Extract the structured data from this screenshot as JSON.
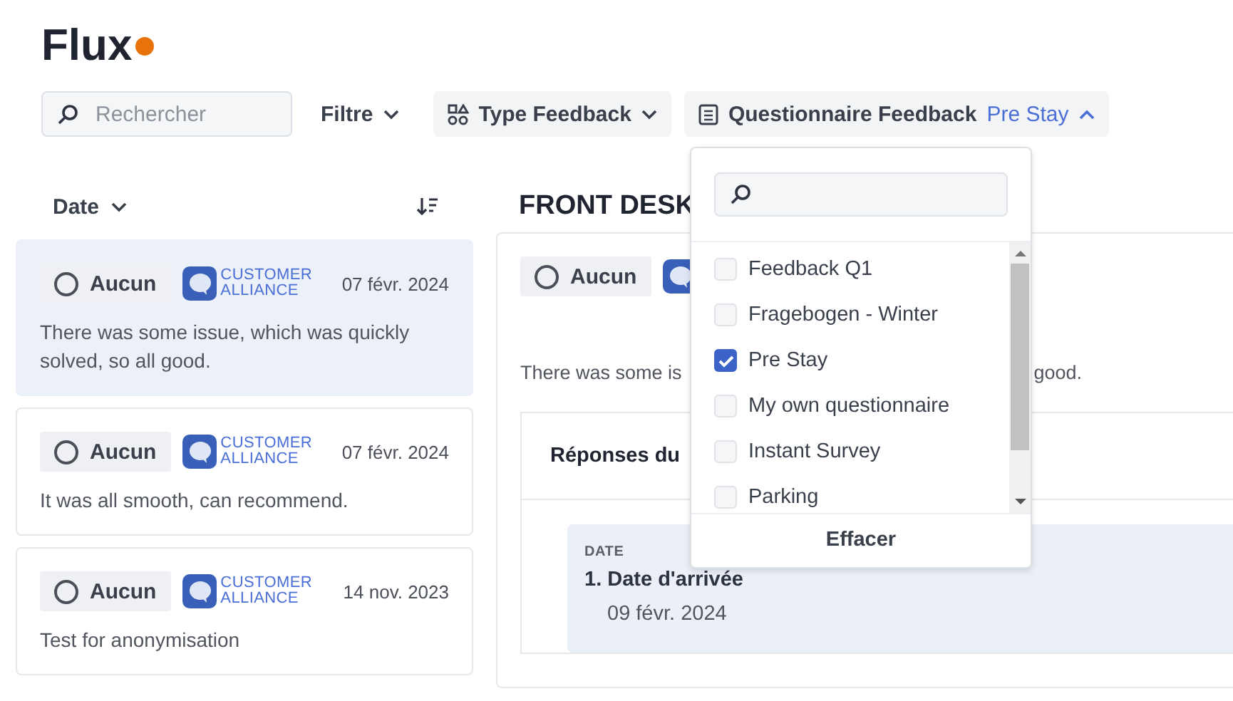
{
  "page": {
    "title": "Flux"
  },
  "toolbar": {
    "search": {
      "placeholder": "Rechercher"
    },
    "filter": {
      "label": "Filtre"
    },
    "type_feedback": {
      "label": "Type Feedback"
    },
    "questionnaire": {
      "label": "Questionnaire Feedback",
      "value": "Pre Stay",
      "expanded": true
    }
  },
  "list_header": {
    "sort_label": "Date"
  },
  "feedback_cards": [
    {
      "status": "Aucun",
      "source": [
        "CUSTOMER",
        "ALLIANCE"
      ],
      "date": "07 févr. 2024",
      "text": "There was some issue, which was quickly solved, so all good.",
      "selected": true
    },
    {
      "status": "Aucun",
      "source": [
        "CUSTOMER",
        "ALLIANCE"
      ],
      "date": "07 févr. 2024",
      "text": "It was all smooth, can recommend.",
      "selected": false
    },
    {
      "status": "Aucun",
      "source": [
        "CUSTOMER",
        "ALLIANCE"
      ],
      "date": "14 nov. 2023",
      "text": "Test for anonymisation",
      "selected": false
    }
  ],
  "detail": {
    "title": "FRONT DESK",
    "status": "Aucun",
    "text_start": "There was some is",
    "text_end": "good.",
    "answers_title": "Réponses du",
    "answer": {
      "section": "DATE",
      "question": "1. Date d'arrivée",
      "value": "09 févr. 2024"
    }
  },
  "dropdown": {
    "options": [
      {
        "label": "Feedback Q1",
        "checked": false
      },
      {
        "label": "Fragebogen - Winter",
        "checked": false
      },
      {
        "label": "Pre Stay",
        "checked": true
      },
      {
        "label": "My own questionnaire",
        "checked": false
      },
      {
        "label": "Instant Survey",
        "checked": false
      },
      {
        "label": "Parking",
        "checked": false
      }
    ],
    "clear_label": "Effacer"
  }
}
